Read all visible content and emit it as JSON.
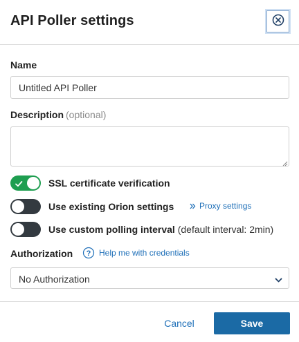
{
  "dialog": {
    "title": "API Poller settings",
    "close_icon": "close-circle-icon"
  },
  "name": {
    "label": "Name",
    "value": "Untitled API Poller"
  },
  "description": {
    "label": "Description",
    "optional": "(optional)",
    "value": ""
  },
  "toggles": [
    {
      "label": "SSL certificate verification",
      "note": "",
      "on": true
    },
    {
      "label": "Use existing Orion settings",
      "note": "",
      "on": false
    },
    {
      "label": "Use custom polling interval",
      "note": "(default interval: 2min)",
      "on": false
    }
  ],
  "proxy_link": {
    "label": "Proxy settings",
    "icon": "double-chevron-right-icon"
  },
  "authorization": {
    "label": "Authorization",
    "help_icon": "question-circle-icon",
    "help_link": "Help me with credentials",
    "selected": "No Authorization"
  },
  "footer": {
    "cancel_label": "Cancel",
    "save_label": "Save"
  },
  "colors": {
    "toggle_on": "#1e9e50",
    "toggle_off": "#333a40",
    "link": "#1e6fb8",
    "primary_button": "#1b6aa5"
  }
}
